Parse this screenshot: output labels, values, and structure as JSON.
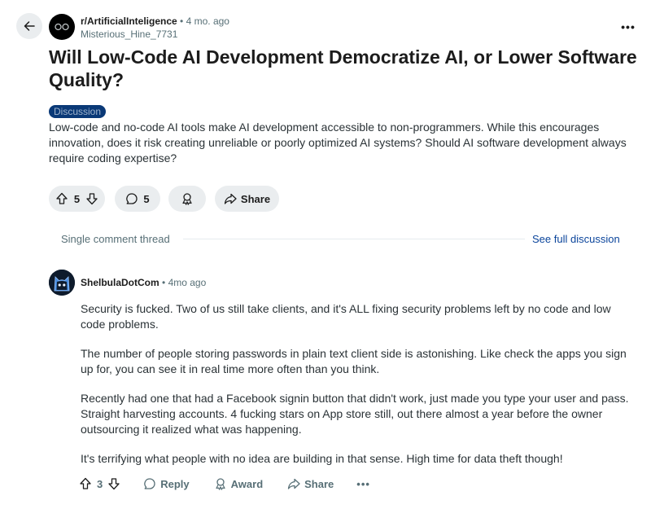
{
  "post": {
    "subreddit": "r/ArtificialInteligence",
    "separator": "•",
    "age": "4 mo. ago",
    "author": "Misterious_Hine_7731",
    "title": "Will Low-Code AI Development Democratize AI, or Lower Software Quality?",
    "flair": "Discussion",
    "flair_color": "#0a3977",
    "body": "Low-code and no-code AI tools make AI development accessible to non-programmers. While this encourages innovation, does it risk creating unreliable or poorly optimized AI systems? Should AI software development always require coding expertise?",
    "votes": "5",
    "comments": "5",
    "share_label": "Share",
    "more_label": "•••"
  },
  "thread": {
    "label": "Single comment thread",
    "see_full_label": "See full discussion",
    "link_color": "#0a449b"
  },
  "comment": {
    "author": "ShelbulaDotCom",
    "separator": "•",
    "age": "4mo ago",
    "paragraphs": [
      "Security is fucked. Two of us still take clients, and it's ALL fixing security problems left by no code and low code problems.",
      "The number of people storing passwords in plain text client side is astonishing. Like check the apps you sign up for, you can see it in real time more often than you think.",
      "Recently had one that had a Facebook signin button that didn't work, just made you type your user and pass. Straight harvesting accounts. 4 fucking stars on App store still, out there almost a year before the owner outsourcing it realized what was happening.",
      "It's terrifying what people with no idea are building in that sense. High time for data theft though!"
    ],
    "votes": "3",
    "reply_label": "Reply",
    "award_label": "Award",
    "share_label": "Share",
    "more_label": "•••"
  },
  "icons": {
    "back": "arrow-left-icon",
    "subreddit_avatar": "subreddit-avatar-icon",
    "upvote": "upvote-arrow-icon",
    "downvote": "downvote-arrow-icon",
    "comment": "speech-bubble-icon",
    "award": "award-ribbon-icon",
    "share": "share-arrow-icon",
    "user_avatar": "cat-avatar-icon"
  }
}
